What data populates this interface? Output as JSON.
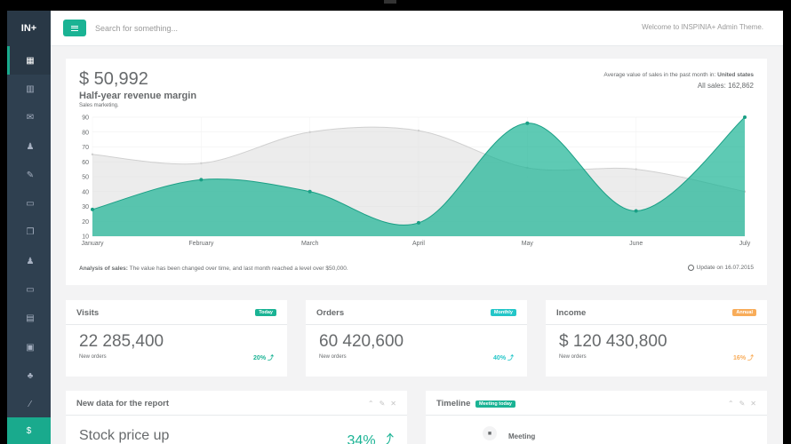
{
  "app": {
    "brand": "IN+",
    "search_placeholder": "Search for something...",
    "welcome": "Welcome to INSPINIA+ Admin Theme."
  },
  "sidebar": {
    "items": [
      {
        "name": "dashboard-icon",
        "active": true
      },
      {
        "name": "bar-chart-icon"
      },
      {
        "name": "envelope-icon"
      },
      {
        "name": "user-icon"
      },
      {
        "name": "edit-icon"
      },
      {
        "name": "desktop-icon"
      },
      {
        "name": "files-icon"
      },
      {
        "name": "sitemap-icon"
      },
      {
        "name": "laptop-icon"
      },
      {
        "name": "table-icon"
      },
      {
        "name": "picture-icon"
      },
      {
        "name": "org-icon"
      },
      {
        "name": "magic-icon"
      }
    ],
    "bottom_icon": "dollar-icon",
    "bottom_glyph": "$"
  },
  "revenue": {
    "amount": "$ 50,992",
    "title": "Half-year revenue margin",
    "subtitle": "Sales marketing.",
    "avg_label": "Average value of sales in the past month in:",
    "avg_region": "United states",
    "all_sales": "All sales: 162,862",
    "analysis_label": "Analysis of sales:",
    "analysis_text": "The value has been changed over time, and last month reached a level over $50,000.",
    "update": "Update on 16.07.2015"
  },
  "chart_data": {
    "type": "area",
    "categories": [
      "January",
      "February",
      "March",
      "April",
      "May",
      "June",
      "July"
    ],
    "ylim": [
      10,
      90
    ],
    "yticks": [
      10,
      20,
      30,
      40,
      50,
      60,
      70,
      80,
      90
    ],
    "series": [
      {
        "values": [
          65,
          59,
          80,
          81,
          56,
          55,
          40
        ],
        "color": "#dcdcdc"
      },
      {
        "values": [
          28,
          48,
          40,
          19,
          86,
          27,
          90
        ],
        "color": "#1ab394"
      }
    ],
    "xlabel": "",
    "ylabel": ""
  },
  "stats": [
    {
      "title": "Visits",
      "badge": "Today",
      "badge_color": "#1ab394",
      "value": "22 285,400",
      "sub": "New orders",
      "pct": "20% ⤴",
      "pct_color": "#1ab394"
    },
    {
      "title": "Orders",
      "badge": "Monthly",
      "badge_color": "#23c6c8",
      "value": "60 420,600",
      "sub": "New orders",
      "pct": "40% ⤴",
      "pct_color": "#23c6c8"
    },
    {
      "title": "Income",
      "badge": "Annual",
      "badge_color": "#f8ac59",
      "value": "$ 120 430,800",
      "sub": "New orders",
      "pct": "16% ⤴",
      "pct_color": "#f8ac59"
    }
  ],
  "report": {
    "title": "New data for the report",
    "stock_label": "Stock price up",
    "stock_pct": "34% ⤴"
  },
  "timeline": {
    "title": "Timeline",
    "badge": "Meeting today",
    "item_title": "Meeting"
  }
}
